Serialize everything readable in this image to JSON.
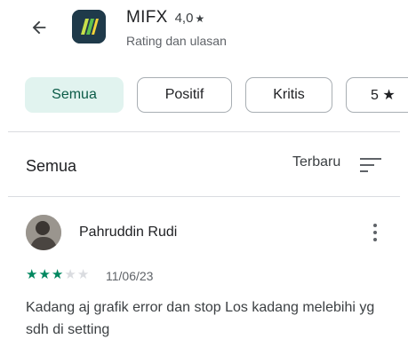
{
  "header": {
    "back_icon": "arrow-back-icon",
    "app_icon": "mifx-logo-icon",
    "app_name": "MIFX",
    "rating": "4,0",
    "rating_star": "★",
    "subtitle": "Rating dan ulasan"
  },
  "filters": [
    {
      "label": "Semua",
      "selected": true
    },
    {
      "label": "Positif",
      "selected": false
    },
    {
      "label": "Kritis",
      "selected": false
    },
    {
      "label": "5 ★",
      "selected": false
    }
  ],
  "section": {
    "title": "Semua",
    "sort_label": "Terbaru",
    "sort_icon": "sort-icon"
  },
  "review": {
    "reviewer": "Pahruddin Rudi",
    "avatar_icon": "avatar",
    "more_icon": "more-vert-icon",
    "stars": 3,
    "max_stars": 5,
    "date": "11/06/23",
    "text": "Kadang aj grafik error dan stop Los kadang melebihi yg sdh di setting"
  },
  "colors": {
    "accent": "#01875f",
    "chip_selected_bg": "#e1f3ef",
    "chip_selected_text": "#0b5b47",
    "app_icon_bg": "#1f3a4a"
  }
}
